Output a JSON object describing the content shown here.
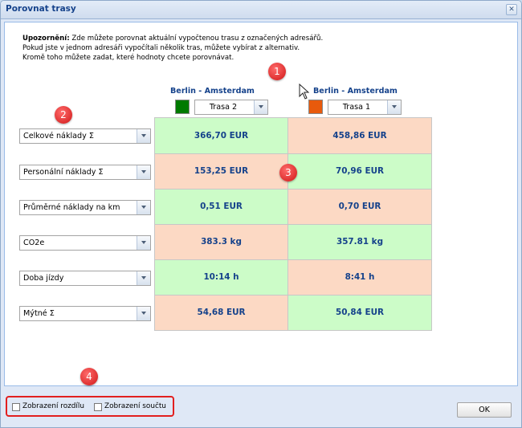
{
  "window": {
    "title": "Porovnat trasy",
    "close_glyph": "✕"
  },
  "notice": {
    "label": "Upozornění:",
    "line1": "Zde můžete porovnat aktuální vypočtenou trasu z označených adresářů.",
    "line2": "Pokud jste v jednom adresáři vypočítali několik tras, můžete vybírat z alternativ.",
    "line3": "Kromě toho můžete zadat, které hodnoty chcete porovnávat."
  },
  "routes": [
    {
      "name": "Berlin - Amsterdam",
      "color": "#007a00",
      "selected": "Trasa 2"
    },
    {
      "name": "Berlin - Amsterdam",
      "color": "#e85a0c",
      "selected": "Trasa 1"
    }
  ],
  "rows": [
    {
      "metric": "Celkové náklady Σ",
      "values": [
        "366,70 EUR",
        "458,86 EUR"
      ],
      "better": 0
    },
    {
      "metric": "Personální náklady Σ",
      "values": [
        "153,25 EUR",
        "70,96 EUR"
      ],
      "better": 1
    },
    {
      "metric": "Průměrné náklady na km",
      "values": [
        "0,51 EUR",
        "0,70 EUR"
      ],
      "better": 0
    },
    {
      "metric": "CO2e",
      "values": [
        "383.3 kg",
        "357.81 kg"
      ],
      "better": 1
    },
    {
      "metric": "Doba jízdy",
      "values": [
        "10:14 h",
        "8:41 h"
      ],
      "better": 0
    },
    {
      "metric": "Mýtné Σ",
      "values": [
        "54,68 EUR",
        "50,84 EUR"
      ],
      "better": 1
    }
  ],
  "badges": [
    "1",
    "2",
    "3",
    "4"
  ],
  "footer": {
    "show_difference": "Zobrazení rozdílu",
    "show_sum": "Zobrazení součtu",
    "ok": "OK"
  },
  "colors": {
    "better": "#ccfcc8",
    "worse": "#fcd9c4",
    "accent": "#15428b",
    "badge": "#d01616"
  }
}
